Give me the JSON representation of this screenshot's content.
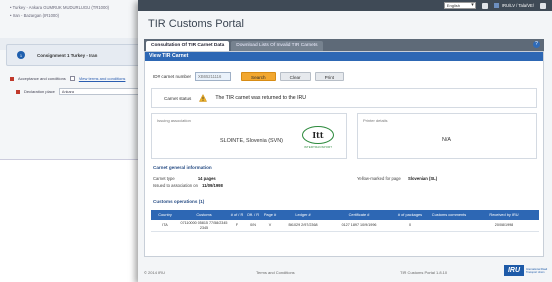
{
  "back_window": {
    "list": [
      "Turkey - Ankara GUMRUK MUDURLUGU (TR1000)",
      "Iran - Bazargan (IR1000)"
    ],
    "consignment_number": "1",
    "consignment_label": "Consignment 1   Turkey - Iran",
    "acceptance_label": "Acceptance and conditions",
    "view_terms_link": "View terms and conditions",
    "declaration_place_label": "Declaration place",
    "declaration_place_value": "Ankara"
  },
  "topbar": {
    "language": "English",
    "user": "IRU/LV / Tala/VE/"
  },
  "portal_title": "TIR Customs Portal",
  "tabs": [
    {
      "label": "Consultation Of TIR Carnet Data"
    },
    {
      "label": "Download Lists Of Invalid TIR Carnets"
    }
  ],
  "help_label": "?",
  "section_title": "View TIR Carnet",
  "search": {
    "label": "ID# carnet number",
    "value": "XB65211116",
    "search_label": "Search",
    "clear_label": "Clear",
    "print_label": "Print"
  },
  "carnet_status": {
    "label": "Carnet status",
    "text": "The TIR carnet was returned to the IRU"
  },
  "issuing_association": {
    "title": "Issuing association",
    "name": "SLOINTE, Slovenia (SVN)",
    "logo_text": "Itt",
    "logo_sub": "INTERTRANSPORT"
  },
  "printer_details": {
    "title": "Printer details",
    "value": "N/A"
  },
  "general_info": {
    "title": "Carnet general information",
    "carnet_type_label": "Carnet type",
    "carnet_type_value": "14 pages",
    "issued_label": "Issued to association on",
    "issued_value": "11/09/1998",
    "yellow_label": "Yellow-marked for page",
    "yellow_value": "Slovenian (SL)"
  },
  "ops": {
    "title": "Customs operations (1)",
    "headers": [
      "Country",
      "Customs",
      "# of / R",
      "Off. / R",
      "Page #",
      "Ledger #",
      "Certificate #",
      "# of packages",
      "Customs comments",
      "Received by IRU"
    ],
    "rows": [
      [
        "ITA",
        "07110000 05815 77/58/2345 2345",
        "F",
        "0/N",
        "V",
        "Bt1029 2/97/2368",
        "0127 1897 10/9/1996",
        "0",
        "",
        "20/08/1998"
      ]
    ]
  },
  "footer": {
    "copyright": "© 2014 IRU",
    "terms": "Terms and Conditions",
    "version": "TIR Customs Portal 1.8.10",
    "logo": "IRU",
    "logo_sub": "International Road Transport Union"
  }
}
